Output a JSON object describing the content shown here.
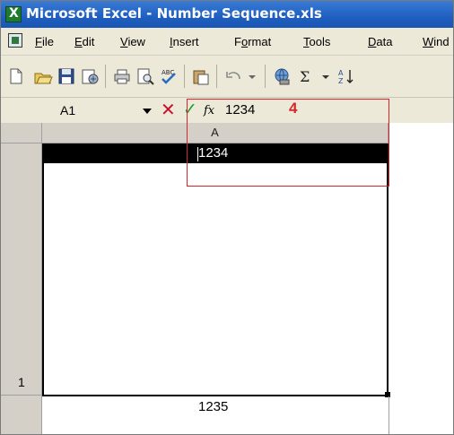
{
  "window": {
    "title": "Microsoft Excel - Number Sequence.xls"
  },
  "menu": {
    "items": [
      {
        "pre": "",
        "u": "F",
        "post": "ile"
      },
      {
        "pre": "",
        "u": "E",
        "post": "dit"
      },
      {
        "pre": "",
        "u": "V",
        "post": "iew"
      },
      {
        "pre": "",
        "u": "I",
        "post": "nsert"
      },
      {
        "pre": "F",
        "u": "o",
        "post": "rmat"
      },
      {
        "pre": "",
        "u": "T",
        "post": "ools"
      },
      {
        "pre": "",
        "u": "D",
        "post": "ata"
      },
      {
        "pre": "",
        "u": "W",
        "post": "ind"
      }
    ]
  },
  "toolbar": {
    "icons": [
      "new-icon",
      "open-icon",
      "save-icon",
      "permission-icon",
      "print-icon",
      "print-preview-icon",
      "spelling-icon",
      "paste-icon",
      "undo-icon",
      "insert-hyperlink-icon",
      "autosum-icon",
      "sort-ascending-icon"
    ]
  },
  "formula_bar": {
    "name_box": "A1",
    "cancel_glyph": "✕",
    "enter_glyph": "✓",
    "fx_label": "fx",
    "value": "1234",
    "callout_number": "4"
  },
  "grid": {
    "column_header": "A",
    "active_cell_value": "1234",
    "row_number": "1",
    "next_cell_value": "1235"
  },
  "colors": {
    "callout": "#d6262b",
    "title_bar": "#1f5fc0",
    "chrome": "#ece9d8"
  }
}
